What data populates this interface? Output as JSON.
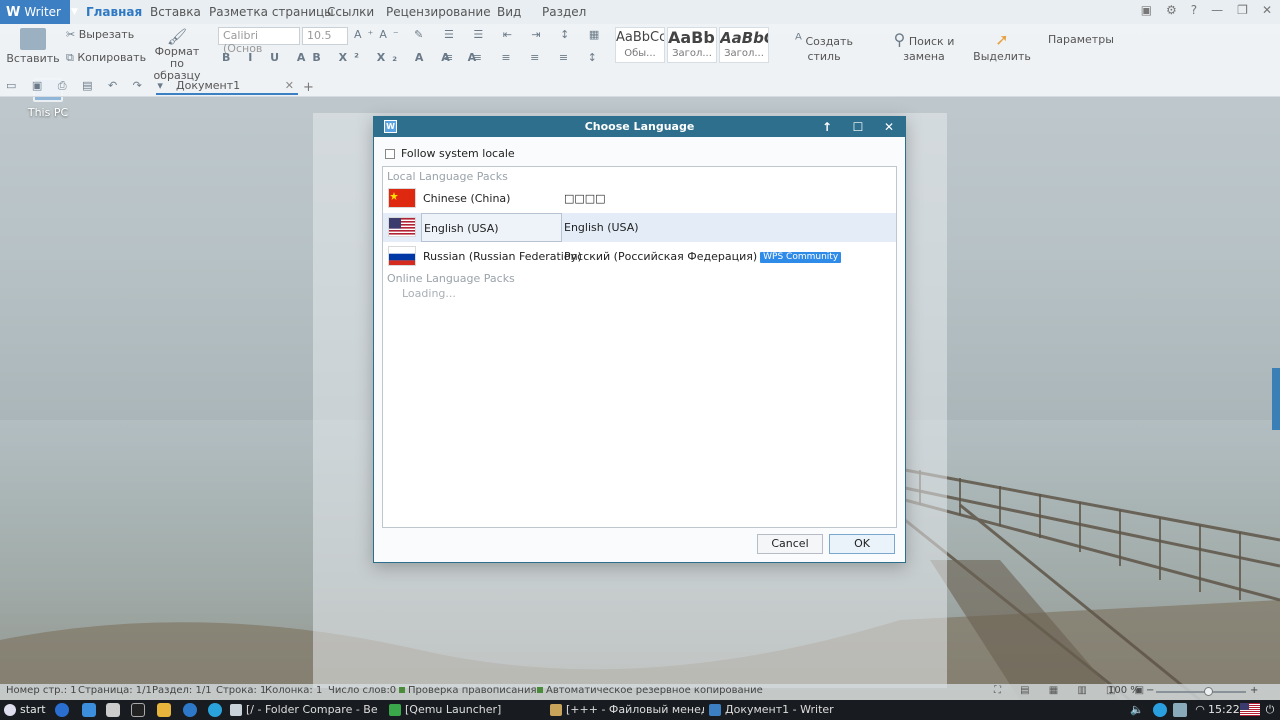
{
  "ribbon": {
    "app_label": "Writer",
    "tabs": [
      "Главная",
      "Вставка",
      "Разметка страницы",
      "Ссылки",
      "Рецензирование",
      "Вид",
      "Раздел"
    ],
    "paste": "Вставить",
    "cut": "Вырезать",
    "copy": "Копировать",
    "format_painter_1": "Формат",
    "format_painter_2": "по образцу",
    "font_name": "Calibri (Основ",
    "font_size": "10.5",
    "styles": [
      {
        "sample": "AaBbCcD",
        "name": "Обы..."
      },
      {
        "sample": "AaBb(",
        "name": "Загол..."
      },
      {
        "sample": "AaBbC",
        "name": "Загол..."
      }
    ],
    "create_style": "Создать стиль",
    "find_replace": "Поиск и замена",
    "select": "Выделить",
    "parameters": "Параметры",
    "doc_tab": "Документ1"
  },
  "desktop": {
    "icon_label": "This PC"
  },
  "dialog": {
    "title": "Choose Language",
    "follow_label": "Follow system locale",
    "follow_checked": false,
    "local_header": "Local Language Packs",
    "languages": [
      {
        "name": "Chinese (China)",
        "native": "□□□□",
        "flag": "cn-flag-icon",
        "badge": ""
      },
      {
        "name": "English (USA)",
        "native": "English (USA)",
        "flag": "us-flag-icon",
        "badge": ""
      },
      {
        "name": "Russian (Russian Federation)",
        "native": "Русский (Российская Федерация)",
        "flag": "ru-flag-icon",
        "badge": "WPS Community"
      }
    ],
    "selected_index": 1,
    "online_header": "Online Language Packs",
    "loading": "Loading...",
    "cancel": "Cancel",
    "ok": "OK"
  },
  "statusbar": {
    "page_num": "Номер стр.: 1",
    "page": "Страница: 1/1",
    "section": "Раздел: 1/1",
    "line": "Строка: 1",
    "column": "Колонка: 1",
    "words": "Число слов:0",
    "spell": "Проверка правописания",
    "autosave": "Автоматическое резервное копирование",
    "zoom": "100 %",
    "zoom_fraction": 0.58
  },
  "taskbar": {
    "start": "start",
    "tasks": [
      "[/ - Folder Compare - Bey...",
      "[Qemu Launcher]",
      "[+++ - Файловый менедж...",
      "Документ1 - Writer"
    ],
    "clock": "15:22"
  },
  "colors": {
    "accent": "#3d7fc3",
    "dialog_title": "#2d6f8d",
    "taskbar": "#181c20",
    "badge": "#2f8be8"
  }
}
